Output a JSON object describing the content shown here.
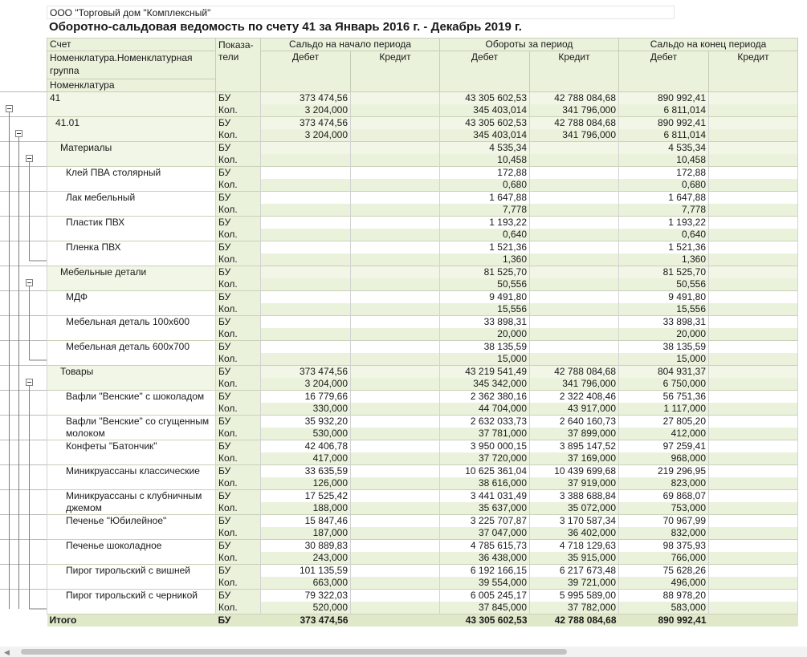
{
  "report": {
    "company": "ООО \"Торговый дом \"Комплексный\"",
    "title": "Оборотно-сальдовая ведомость по счету 41 за Январь 2016 г. - Декабрь 2019 г."
  },
  "header": {
    "account": "Счет",
    "group": "Номенклатура.Номенклатурная группа",
    "item": "Номенклатура",
    "indicators": "Показа-тели",
    "opening": "Сальдо на начало периода",
    "turnover": "Обороты за период",
    "closing": "Сальдо на конец периода",
    "debit": "Дебет",
    "credit": "Кредит"
  },
  "rows": [
    {
      "name": "41",
      "level": 0,
      "group": true,
      "bu": [
        "373 474,56",
        "",
        "43 305 602,53",
        "42 788 084,68",
        "890 992,41",
        ""
      ],
      "kol": [
        "3 204,000",
        "",
        "345 403,014",
        "341 796,000",
        "6 811,014",
        ""
      ]
    },
    {
      "name": "41.01",
      "level": 1,
      "group": true,
      "bu": [
        "373 474,56",
        "",
        "43 305 602,53",
        "42 788 084,68",
        "890 992,41",
        ""
      ],
      "kol": [
        "3 204,000",
        "",
        "345 403,014",
        "341 796,000",
        "6 811,014",
        ""
      ]
    },
    {
      "name": "Материалы",
      "level": 2,
      "group": true,
      "bu": [
        "",
        "",
        "4 535,34",
        "",
        "4 535,34",
        ""
      ],
      "kol": [
        "",
        "",
        "10,458",
        "",
        "10,458",
        ""
      ]
    },
    {
      "name": "Клей ПВА столярный",
      "level": 3,
      "bu": [
        "",
        "",
        "172,88",
        "",
        "172,88",
        ""
      ],
      "kol": [
        "",
        "",
        "0,680",
        "",
        "0,680",
        ""
      ]
    },
    {
      "name": "Лак мебельный",
      "level": 3,
      "bu": [
        "",
        "",
        "1 647,88",
        "",
        "1 647,88",
        ""
      ],
      "kol": [
        "",
        "",
        "7,778",
        "",
        "7,778",
        ""
      ]
    },
    {
      "name": "Пластик ПВХ",
      "level": 3,
      "bu": [
        "",
        "",
        "1 193,22",
        "",
        "1 193,22",
        ""
      ],
      "kol": [
        "",
        "",
        "0,640",
        "",
        "0,640",
        ""
      ]
    },
    {
      "name": "Пленка ПВХ",
      "level": 3,
      "bu": [
        "",
        "",
        "1 521,36",
        "",
        "1 521,36",
        ""
      ],
      "kol": [
        "",
        "",
        "1,360",
        "",
        "1,360",
        ""
      ]
    },
    {
      "name": "Мебельные детали",
      "level": 2,
      "group": true,
      "bu": [
        "",
        "",
        "81 525,70",
        "",
        "81 525,70",
        ""
      ],
      "kol": [
        "",
        "",
        "50,556",
        "",
        "50,556",
        ""
      ]
    },
    {
      "name": "МДФ",
      "level": 3,
      "bu": [
        "",
        "",
        "9 491,80",
        "",
        "9 491,80",
        ""
      ],
      "kol": [
        "",
        "",
        "15,556",
        "",
        "15,556",
        ""
      ]
    },
    {
      "name": "Мебельная деталь 100х600",
      "level": 3,
      "bu": [
        "",
        "",
        "33 898,31",
        "",
        "33 898,31",
        ""
      ],
      "kol": [
        "",
        "",
        "20,000",
        "",
        "20,000",
        ""
      ]
    },
    {
      "name": "Мебельная деталь 600х700",
      "level": 3,
      "bu": [
        "",
        "",
        "38 135,59",
        "",
        "38 135,59",
        ""
      ],
      "kol": [
        "",
        "",
        "15,000",
        "",
        "15,000",
        ""
      ]
    },
    {
      "name": "Товары",
      "level": 2,
      "group": true,
      "bu": [
        "373 474,56",
        "",
        "43 219 541,49",
        "42 788 084,68",
        "804 931,37",
        ""
      ],
      "kol": [
        "3 204,000",
        "",
        "345 342,000",
        "341 796,000",
        "6 750,000",
        ""
      ]
    },
    {
      "name": "Вафли \"Венские\" с шоколадом",
      "level": 3,
      "bu": [
        "16 779,66",
        "",
        "2 362 380,16",
        "2 322 408,46",
        "56 751,36",
        ""
      ],
      "kol": [
        "330,000",
        "",
        "44 704,000",
        "43 917,000",
        "1 117,000",
        ""
      ]
    },
    {
      "name": "Вафли \"Венские\" со сгущенным молоком",
      "level": 3,
      "bu": [
        "35 932,20",
        "",
        "2 632 033,73",
        "2 640 160,73",
        "27 805,20",
        ""
      ],
      "kol": [
        "530,000",
        "",
        "37 781,000",
        "37 899,000",
        "412,000",
        ""
      ]
    },
    {
      "name": "Конфеты \"Батончик\"",
      "level": 3,
      "bu": [
        "42 406,78",
        "",
        "3 950 000,15",
        "3 895 147,52",
        "97 259,41",
        ""
      ],
      "kol": [
        "417,000",
        "",
        "37 720,000",
        "37 169,000",
        "968,000",
        ""
      ]
    },
    {
      "name": "Миникруассаны классические",
      "level": 3,
      "bu": [
        "33 635,59",
        "",
        "10 625 361,04",
        "10 439 699,68",
        "219 296,95",
        ""
      ],
      "kol": [
        "126,000",
        "",
        "38 616,000",
        "37 919,000",
        "823,000",
        ""
      ]
    },
    {
      "name": "Миникруассаны с клубничным джемом",
      "level": 3,
      "bu": [
        "17 525,42",
        "",
        "3 441 031,49",
        "3 388 688,84",
        "69 868,07",
        ""
      ],
      "kol": [
        "188,000",
        "",
        "35 637,000",
        "35 072,000",
        "753,000",
        ""
      ]
    },
    {
      "name": "Печенье \"Юбилейное\"",
      "level": 3,
      "bu": [
        "15 847,46",
        "",
        "3 225 707,87",
        "3 170 587,34",
        "70 967,99",
        ""
      ],
      "kol": [
        "187,000",
        "",
        "37 047,000",
        "36 402,000",
        "832,000",
        ""
      ]
    },
    {
      "name": "Печенье шоколадное",
      "level": 3,
      "bu": [
        "30 889,83",
        "",
        "4 785 615,73",
        "4 718 129,63",
        "98 375,93",
        ""
      ],
      "kol": [
        "243,000",
        "",
        "36 438,000",
        "35 915,000",
        "766,000",
        ""
      ]
    },
    {
      "name": "Пирог тирольский с вишней",
      "level": 3,
      "bu": [
        "101 135,59",
        "",
        "6 192 166,15",
        "6 217 673,48",
        "75 628,26",
        ""
      ],
      "kol": [
        "663,000",
        "",
        "39 554,000",
        "39 721,000",
        "496,000",
        ""
      ]
    },
    {
      "name": "Пирог тирольский с черникой",
      "level": 3,
      "bu": [
        "79 322,03",
        "",
        "6 005 245,17",
        "5 995 589,00",
        "88 978,20",
        ""
      ],
      "kol": [
        "520,000",
        "",
        "37 845,000",
        "37 782,000",
        "583,000",
        ""
      ]
    }
  ],
  "labels": {
    "bu": "БУ",
    "kol": "Кол."
  },
  "total": {
    "name": "Итого",
    "ind": "БУ",
    "values": [
      "373 474,56",
      "",
      "43 305 602,53",
      "42 788 084,68",
      "890 992,41",
      ""
    ]
  },
  "colors": {
    "header_bg": "#ebf2dc",
    "group_bg": "#f1f6e6",
    "total_bg": "#dfe8c9",
    "border": "#d3d3d3"
  },
  "icons": {
    "collapse": "minus-box-icon"
  }
}
